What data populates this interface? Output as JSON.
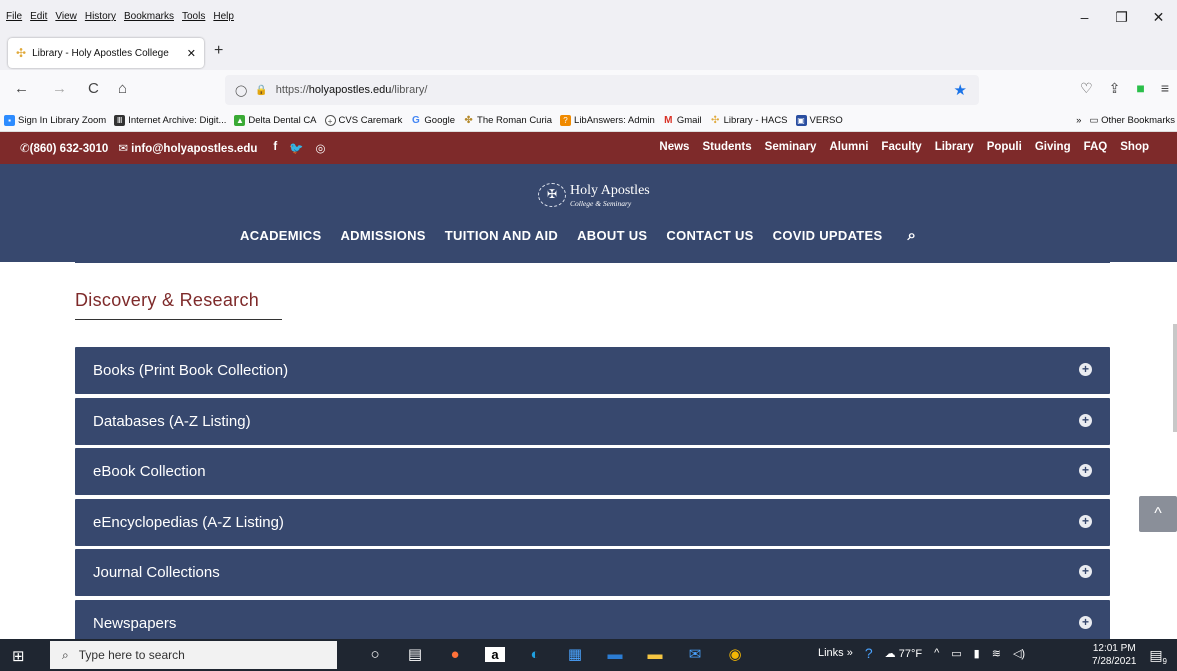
{
  "browser": {
    "menu": [
      "File",
      "Edit",
      "View",
      "History",
      "Bookmarks",
      "Tools",
      "Help"
    ],
    "window_controls": [
      "–",
      "❐",
      "✕"
    ],
    "tab": {
      "title": "Library - Holy Apostles College",
      "close": "✕"
    },
    "new_tab": "+",
    "nav": {
      "back": "←",
      "forward": "→",
      "reload": "C",
      "home": "⌂"
    },
    "url": {
      "shield": "◯",
      "lock": "🔒",
      "prefix": "https://",
      "host": "holyapostles.edu",
      "path": "/library/",
      "star": "★"
    },
    "nav_right": [
      "♡",
      "⇪",
      "■",
      "≡"
    ],
    "bookmarks": [
      {
        "label": "Sign In Library Zoom",
        "color": "#2d8cff"
      },
      {
        "label": "Internet Archive: Digit...",
        "color": "#333333"
      },
      {
        "label": "Delta Dental CA",
        "color": "#3aaa35"
      },
      {
        "label": "CVS Caremark",
        "color": "#555555"
      },
      {
        "label": "Google",
        "color": "#4285f4"
      },
      {
        "label": "The Roman Curia",
        "color": "#b58a2c"
      },
      {
        "label": "LibAnswers: Admin",
        "color": "#f08a00"
      },
      {
        "label": "Gmail",
        "color": "#d93025"
      },
      {
        "label": "Library - HACS",
        "color": "#e0a93a"
      },
      {
        "label": "VERSO",
        "color": "#2a4ea0"
      }
    ],
    "bookmarks_overflow": "»",
    "other_bookmarks": "Other Bookmarks"
  },
  "site": {
    "phone": "(860) 632-3010",
    "email": "info@holyapostles.edu",
    "social": [
      "f",
      "🐦",
      "◎"
    ],
    "top_links": [
      "News",
      "Students",
      "Seminary",
      "Alumni",
      "Faculty",
      "Library",
      "Populi",
      "Giving",
      "FAQ",
      "Shop"
    ],
    "logo_name": "Holy Apostles",
    "logo_sub": "College & Seminary",
    "main_nav": [
      "ACADEMICS",
      "ADMISSIONS",
      "TUITION AND AID",
      "ABOUT US",
      "CONTACT US",
      "COVID UPDATES"
    ],
    "section_title": "Discovery & Research",
    "accordion": [
      "Books (Print Book Collection)",
      "Databases (A-Z Listing)",
      "eBook Collection",
      "eEncyclopedias (A-Z Listing)",
      "Journal Collections",
      "Newspapers"
    ],
    "scroll_top": "^"
  },
  "taskbar": {
    "search_placeholder": "Type here to search",
    "links_label": "Links",
    "weather": "77°F",
    "time": "12:01 PM",
    "date": "7/28/2021",
    "notifications": "9"
  }
}
